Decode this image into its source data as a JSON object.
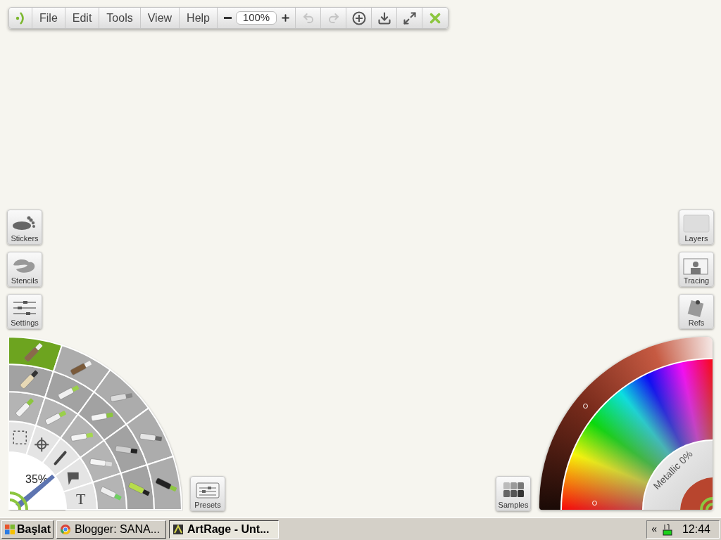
{
  "toolbar": {
    "menus": [
      "File",
      "Edit",
      "Tools",
      "View",
      "Help"
    ],
    "zoom": "100%",
    "actions": [
      {
        "kind": "undo",
        "disabled": true
      },
      {
        "kind": "redo",
        "disabled": true
      },
      {
        "kind": "recenter",
        "disabled": false
      },
      {
        "kind": "save",
        "disabled": false
      },
      {
        "kind": "fullscreen",
        "disabled": false
      },
      {
        "kind": "close",
        "disabled": false
      }
    ]
  },
  "left_panels": [
    {
      "kind": "stickers",
      "label": "Stickers"
    },
    {
      "kind": "stencils",
      "label": "Stencils"
    },
    {
      "kind": "settings",
      "label": "Settings"
    }
  ],
  "right_panels": [
    {
      "kind": "layers",
      "label": "Layers"
    },
    {
      "kind": "tracing",
      "label": "Tracing"
    },
    {
      "kind": "refs",
      "label": "Refs"
    }
  ],
  "presets": {
    "label": "Presets"
  },
  "samples": {
    "label": "Samples"
  },
  "tool_wheel": {
    "size_label": "35%",
    "rings": [
      {
        "tools": [
          {
            "kind": "select",
            "selected": false
          },
          {
            "kind": "transform",
            "selected": false
          },
          {
            "kind": "picker",
            "selected": false
          },
          {
            "kind": "fill",
            "selected": false
          },
          {
            "kind": "text",
            "label": "T",
            "selected": false
          }
        ]
      },
      {
        "tools": [
          {
            "kind": "tube",
            "selected": false
          },
          {
            "kind": "eraser",
            "selected": false
          },
          {
            "kind": "crayon",
            "selected": false
          },
          {
            "kind": "paint-tube",
            "selected": false
          },
          {
            "kind": "glitter",
            "selected": false
          }
        ]
      },
      {
        "tools": [
          {
            "kind": "pencil",
            "selected": false
          },
          {
            "kind": "roller",
            "selected": false
          },
          {
            "kind": "marker",
            "selected": false
          },
          {
            "kind": "pen",
            "selected": false
          },
          {
            "kind": "sticker-spray",
            "selected": false
          }
        ]
      },
      {
        "tools": [
          {
            "kind": "flat-brush",
            "selected": true
          },
          {
            "kind": "round-brush",
            "selected": false
          },
          {
            "kind": "knife",
            "selected": false
          },
          {
            "kind": "airbrush",
            "selected": false
          },
          {
            "kind": "inking-pen",
            "selected": false
          }
        ]
      }
    ]
  },
  "color_picker": {
    "metallic_label": "Metallic 0%"
  },
  "taskbar": {
    "start": "Başlat",
    "tasks": [
      {
        "label": "Blogger: SANA...",
        "kind": "browser",
        "selected": false
      },
      {
        "label": "ArtRage - Unt...",
        "kind": "artrage",
        "selected": true
      }
    ],
    "tray_toggle": "«",
    "clock": "12:44"
  }
}
